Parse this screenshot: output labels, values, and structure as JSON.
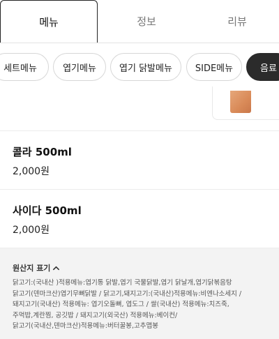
{
  "tabs": [
    {
      "label": "메뉴",
      "active": true
    },
    {
      "label": "정보",
      "active": false
    },
    {
      "label": "리뷰",
      "active": false
    }
  ],
  "categories": [
    {
      "label": "세트메뉴",
      "active": false
    },
    {
      "label": "엽기메뉴",
      "active": false
    },
    {
      "label": "엽기 닭발메뉴",
      "active": false
    },
    {
      "label": "SIDE메뉴",
      "active": false
    },
    {
      "label": "음료",
      "active": true
    }
  ],
  "menu_items": [
    {
      "name": "콜라 500ml",
      "price": "2,000원"
    },
    {
      "name": "사이다 500ml",
      "price": "2,000원"
    }
  ],
  "origin": {
    "title": "원산지 표기",
    "lines": [
      "닭고기:(국내산 )적용메뉴:엽기통 닭발,엽기 국물닭발,엽기 닭날개,엽기닭볶음탕",
      "닭고기(덴마크산)엽기무뼈닭발 / 닭고기,돼지고기:(국내산)적용메뉴:비엔나소세지 /",
      "돼지고기(국내산) 적용메뉴: 엽기오돌뼈, 엽도그 / 쌀(국내산) 적용메뉴:치즈죽,",
      "주먹밥,계란찜, 공깃밥 / 돼지고기(외국산) 적용메뉴:베이컨/",
      "닭고기(국내산,덴마크산)적용메뉴:버터꿀봉,고추맵봉"
    ]
  },
  "colors": {
    "active_chip_bg": "#2b2b2b",
    "origin_bg": "#f3f3f3"
  }
}
